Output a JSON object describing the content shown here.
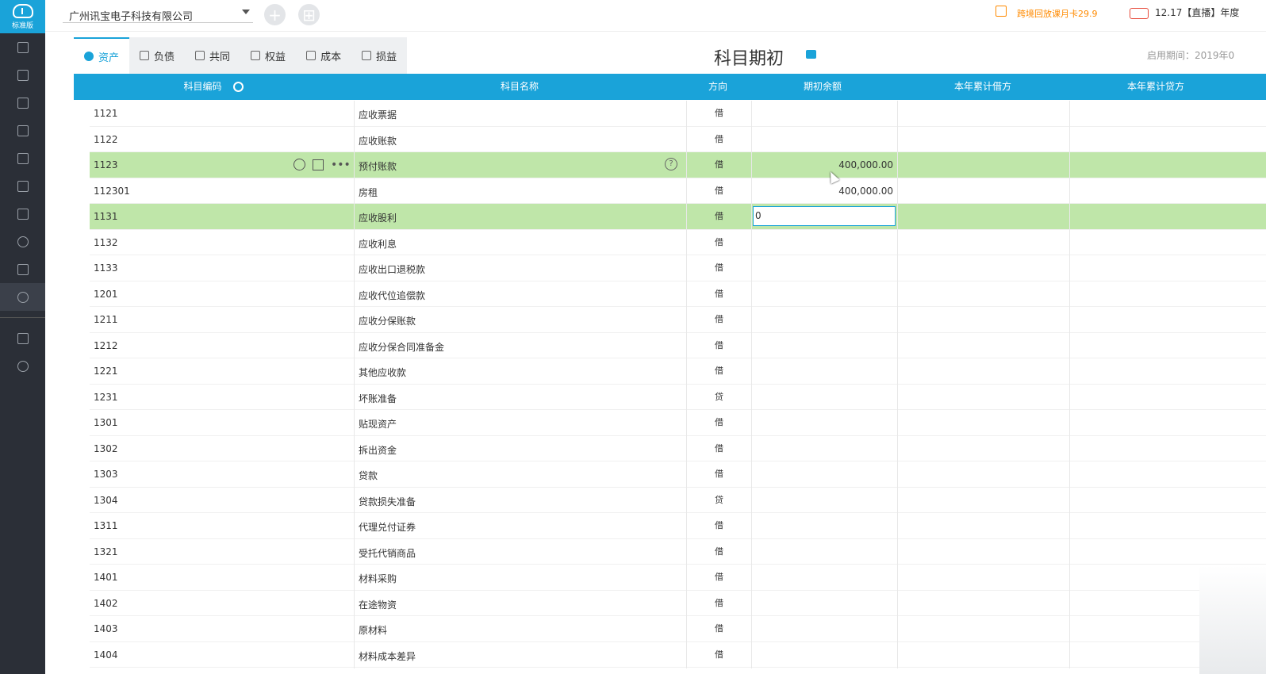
{
  "sidebar": {
    "logo_text": "标准版",
    "icons": [
      "voucher-icon",
      "ledger-icon",
      "chart-icon",
      "report-icon",
      "asset-icon",
      "book-icon",
      "shirt-icon",
      "salary-icon",
      "invoice-icon",
      "settings-icon",
      "video-icon",
      "speed-icon"
    ]
  },
  "topbar": {
    "company": "广州讯宝电子科技有限公司",
    "promo": "跨境回放课月卡29.9",
    "live": "12.17【直播】年度"
  },
  "tabs": [
    {
      "label": "资产",
      "active": true
    },
    {
      "label": "负债"
    },
    {
      "label": "共同"
    },
    {
      "label": "权益"
    },
    {
      "label": "成本"
    },
    {
      "label": "损益"
    }
  ],
  "title": "科目期初",
  "period": "启用期间：2019年0",
  "table": {
    "headers": {
      "code": "科目编码",
      "name": "科目名称",
      "direction": "方向",
      "opening": "期初余额",
      "debit": "本年累计借方",
      "credit": "本年累计贷方"
    },
    "rows": [
      {
        "code": "1121",
        "name": "应收票据",
        "dir": "借",
        "bal": ""
      },
      {
        "code": "1122",
        "name": "应收账款",
        "dir": "借",
        "bal": ""
      },
      {
        "code": "1123",
        "name": "预付账款",
        "dir": "借",
        "bal": "400,000.00",
        "hl": true,
        "actions": true,
        "help": true
      },
      {
        "code": "112301",
        "name": "房租",
        "dir": "借",
        "bal": "400,000.00"
      },
      {
        "code": "1131",
        "name": "应收股利",
        "dir": "借",
        "bal": "",
        "hl": true,
        "editing": true,
        "edit_value": "0"
      },
      {
        "code": "1132",
        "name": "应收利息",
        "dir": "借",
        "bal": ""
      },
      {
        "code": "1133",
        "name": "应收出口退税款",
        "dir": "借",
        "bal": ""
      },
      {
        "code": "1201",
        "name": "应收代位追偿款",
        "dir": "借",
        "bal": ""
      },
      {
        "code": "1211",
        "name": "应收分保账款",
        "dir": "借",
        "bal": ""
      },
      {
        "code": "1212",
        "name": "应收分保合同准备金",
        "dir": "借",
        "bal": ""
      },
      {
        "code": "1221",
        "name": "其他应收款",
        "dir": "借",
        "bal": ""
      },
      {
        "code": "1231",
        "name": "坏账准备",
        "dir": "贷",
        "bal": ""
      },
      {
        "code": "1301",
        "name": "贴现资产",
        "dir": "借",
        "bal": ""
      },
      {
        "code": "1302",
        "name": "拆出资金",
        "dir": "借",
        "bal": ""
      },
      {
        "code": "1303",
        "name": "贷款",
        "dir": "借",
        "bal": ""
      },
      {
        "code": "1304",
        "name": "贷款损失准备",
        "dir": "贷",
        "bal": ""
      },
      {
        "code": "1311",
        "name": "代理兑付证券",
        "dir": "借",
        "bal": ""
      },
      {
        "code": "1321",
        "name": "受托代销商品",
        "dir": "借",
        "bal": ""
      },
      {
        "code": "1401",
        "name": "材料采购",
        "dir": "借",
        "bal": ""
      },
      {
        "code": "1402",
        "name": "在途物资",
        "dir": "借",
        "bal": ""
      },
      {
        "code": "1403",
        "name": "原材料",
        "dir": "借",
        "bal": ""
      },
      {
        "code": "1404",
        "name": "材料成本差异",
        "dir": "借",
        "bal": ""
      }
    ]
  }
}
